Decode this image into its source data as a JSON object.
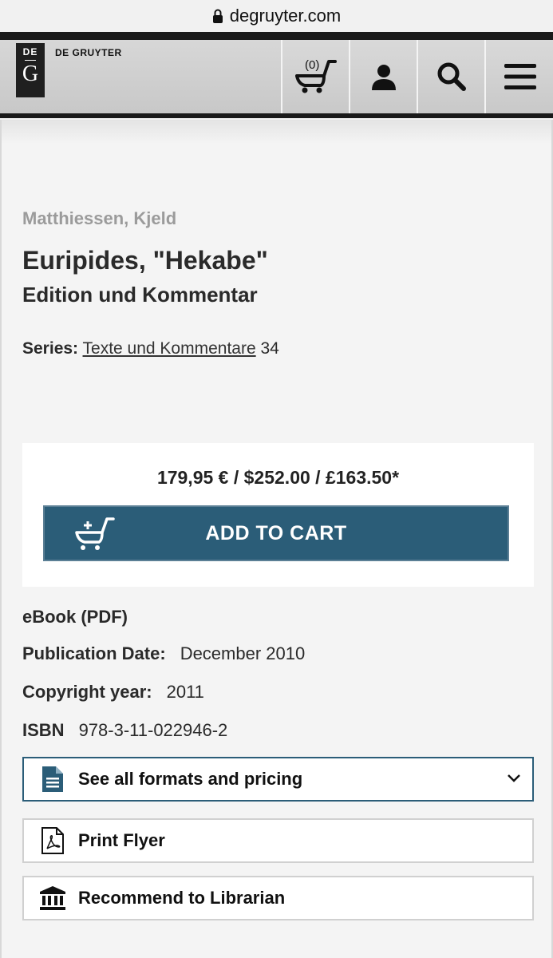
{
  "browser": {
    "url": "degruyter.com"
  },
  "header": {
    "logo_top": "DE",
    "logo_bottom": "G",
    "brand": "DE GRUYTER",
    "cart_count": "(0)"
  },
  "book": {
    "author": "Matthiessen, Kjeld",
    "title": "Euripides, \"Hekabe\"",
    "subtitle": "Edition und Kommentar",
    "series_label": "Series:",
    "series_name": "Texte und Kommentare",
    "series_number": "34"
  },
  "purchase": {
    "price": "179,95 € / $252.00 / £163.50*",
    "add_to_cart": "ADD TO CART"
  },
  "details": {
    "format": "eBook (PDF)",
    "pub_date_label": "Publication Date:",
    "pub_date": "December 2010",
    "copyright_label": "Copyright year:",
    "copyright": "2011",
    "isbn_label": "ISBN",
    "isbn": "978-3-11-022946-2"
  },
  "actions": {
    "formats": "See all formats and pricing",
    "flyer": "Print Flyer",
    "librarian": "Recommend to Librarian"
  },
  "colors": {
    "accent": "#2b5d78",
    "header_bg": "#1a1a1a",
    "muted": "#9b9b9b"
  }
}
